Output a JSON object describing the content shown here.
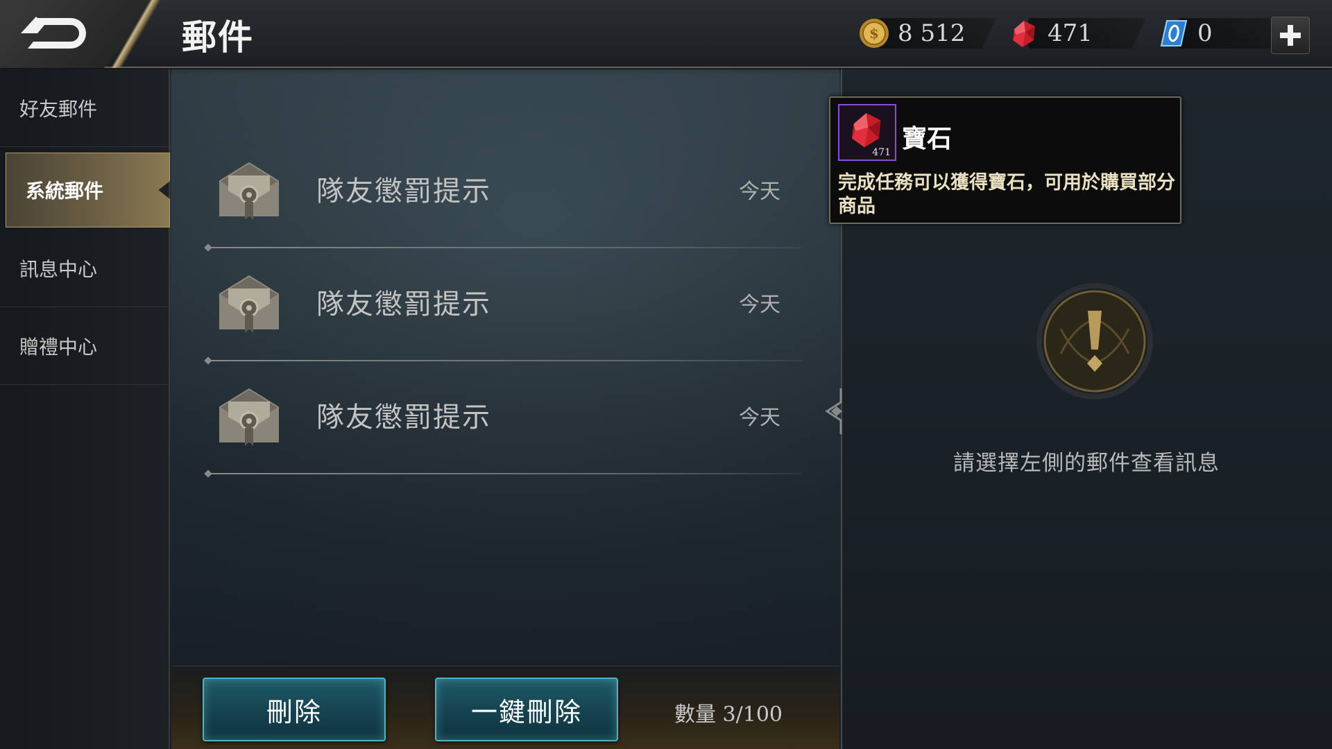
{
  "header": {
    "title": "郵件",
    "back_icon": "back-arrow-icon",
    "currencies": [
      {
        "name": "coin",
        "icon": "gold-coin-icon",
        "value": "8 512"
      },
      {
        "name": "gem",
        "icon": "red-gem-icon",
        "value": "471"
      },
      {
        "name": "voucher",
        "icon": "blue-voucher-icon",
        "value": "0"
      }
    ],
    "plus_icon": "plus-icon"
  },
  "sidebar": {
    "items": [
      {
        "label": "好友郵件",
        "active": false
      },
      {
        "label": "系統郵件",
        "active": true
      },
      {
        "label": "訊息中心",
        "active": false
      },
      {
        "label": "贈禮中心",
        "active": false
      }
    ]
  },
  "mail_list": {
    "items": [
      {
        "icon": "mail-envelope-icon",
        "subject": "隊友懲罰提示",
        "date": "今天"
      },
      {
        "icon": "mail-envelope-icon",
        "subject": "隊友懲罰提示",
        "date": "今天"
      },
      {
        "icon": "mail-envelope-icon",
        "subject": "隊友懲罰提示",
        "date": "今天"
      }
    ]
  },
  "actions": {
    "delete_label": "刪除",
    "delete_all_label": "一鍵刪除",
    "count_label": "數量",
    "count_value": "3/100"
  },
  "tooltip": {
    "item_name": "寶石",
    "item_count": "471",
    "description": "完成任務可以獲得寶石，可用於購買部分商品",
    "icon": "red-gem-icon",
    "border_color": "#8a4fd8"
  },
  "detail": {
    "empty_hint": "請選擇左側的郵件查看訊息",
    "emblem_icon": "exclamation-emblem-icon"
  },
  "colors": {
    "accent_gold": "#b49c64",
    "button_teal": "#4fb3c6",
    "gem_red": "#e0303a"
  }
}
